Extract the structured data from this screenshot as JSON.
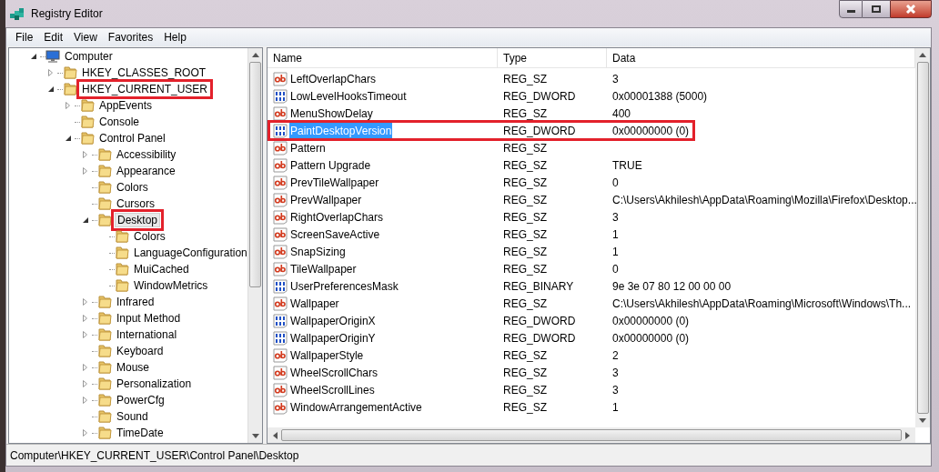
{
  "window": {
    "title": "Registry Editor"
  },
  "menu": [
    "File",
    "Edit",
    "View",
    "Favorites",
    "Help"
  ],
  "tree": [
    {
      "name": "Computer",
      "kind": "computer",
      "expanded": true,
      "children": [
        {
          "name": "HKEY_CLASSES_ROOT",
          "expanded": false
        },
        {
          "name": "HKEY_CURRENT_USER",
          "expanded": true,
          "highlighted": true,
          "children": [
            {
              "name": "AppEvents",
              "expanded": false
            },
            {
              "name": "Console"
            },
            {
              "name": "Control Panel",
              "expanded": true,
              "children": [
                {
                  "name": "Accessibility",
                  "expanded": false
                },
                {
                  "name": "Appearance",
                  "expanded": false
                },
                {
                  "name": "Colors"
                },
                {
                  "name": "Cursors"
                },
                {
                  "name": "Desktop",
                  "expanded": true,
                  "selected": true,
                  "highlighted": true,
                  "children": [
                    {
                      "name": "Colors"
                    },
                    {
                      "name": "LanguageConfiguration"
                    },
                    {
                      "name": "MuiCached"
                    },
                    {
                      "name": "WindowMetrics"
                    }
                  ]
                },
                {
                  "name": "Infrared",
                  "expanded": false
                },
                {
                  "name": "Input Method",
                  "expanded": false
                },
                {
                  "name": "International",
                  "expanded": false
                },
                {
                  "name": "Keyboard"
                },
                {
                  "name": "Mouse",
                  "expanded": false
                },
                {
                  "name": "Personalization",
                  "expanded": false
                },
                {
                  "name": "PowerCfg",
                  "expanded": false
                },
                {
                  "name": "Sound"
                },
                {
                  "name": "TimeDate",
                  "expanded": false
                }
              ]
            }
          ]
        }
      ]
    }
  ],
  "table": {
    "columns": [
      "Name",
      "Type",
      "Data"
    ],
    "rows": [
      {
        "kind": "sz",
        "name": "LeftOverlapChars",
        "type": "REG_SZ",
        "data": "3",
        "selected": false,
        "highlighted": false
      },
      {
        "kind": "bin",
        "name": "LowLevelHooksTimeout",
        "type": "REG_DWORD",
        "data": "0x00001388 (5000)",
        "selected": false,
        "highlighted": false
      },
      {
        "kind": "sz",
        "name": "MenuShowDelay",
        "type": "REG_SZ",
        "data": "400",
        "selected": false,
        "highlighted": false
      },
      {
        "kind": "bin",
        "name": "PaintDesktopVersion",
        "type": "REG_DWORD",
        "data": "0x00000000 (0)",
        "selected": true,
        "highlighted": true
      },
      {
        "kind": "sz",
        "name": "Pattern",
        "type": "REG_SZ",
        "selected": false,
        "highlighted": false
      },
      {
        "kind": "sz",
        "name": "Pattern Upgrade",
        "type": "REG_SZ",
        "data": "TRUE",
        "selected": false,
        "highlighted": false
      },
      {
        "kind": "sz",
        "name": "PrevTileWallpaper",
        "type": "REG_SZ",
        "data": "0",
        "selected": false,
        "highlighted": false
      },
      {
        "kind": "sz",
        "name": "PrevWallpaper",
        "type": "REG_SZ",
        "data": "C:\\Users\\Akhilesh\\AppData\\Roaming\\Mozilla\\Firefox\\Desktop...",
        "selected": false,
        "highlighted": false
      },
      {
        "kind": "sz",
        "name": "RightOverlapChars",
        "type": "REG_SZ",
        "data": "3",
        "selected": false,
        "highlighted": false
      },
      {
        "kind": "sz",
        "name": "ScreenSaveActive",
        "type": "REG_SZ",
        "data": "1",
        "selected": false,
        "highlighted": false
      },
      {
        "kind": "sz",
        "name": "SnapSizing",
        "type": "REG_SZ",
        "data": "1",
        "selected": false,
        "highlighted": false
      },
      {
        "kind": "sz",
        "name": "TileWallpaper",
        "type": "REG_SZ",
        "data": "0",
        "selected": false,
        "highlighted": false
      },
      {
        "kind": "bin",
        "name": "UserPreferencesMask",
        "type": "REG_BINARY",
        "data": "9e 3e 07 80 12 00 00 00",
        "selected": false,
        "highlighted": false
      },
      {
        "kind": "sz",
        "name": "Wallpaper",
        "type": "REG_SZ",
        "data": "C:\\Users\\Akhilesh\\AppData\\Roaming\\Microsoft\\Windows\\Th...",
        "selected": false,
        "highlighted": false
      },
      {
        "kind": "bin",
        "name": "WallpaperOriginX",
        "type": "REG_DWORD",
        "data": "0x00000000 (0)",
        "selected": false,
        "highlighted": false
      },
      {
        "kind": "bin",
        "name": "WallpaperOriginY",
        "type": "REG_DWORD",
        "data": "0x00000000 (0)",
        "selected": false,
        "highlighted": false
      },
      {
        "kind": "sz",
        "name": "WallpaperStyle",
        "type": "REG_SZ",
        "data": "2",
        "selected": false,
        "highlighted": false
      },
      {
        "kind": "sz",
        "name": "WheelScrollChars",
        "type": "REG_SZ",
        "data": "3",
        "selected": false,
        "highlighted": false
      },
      {
        "kind": "sz",
        "name": "WheelScrollLines",
        "type": "REG_SZ",
        "data": "3",
        "selected": false,
        "highlighted": false
      },
      {
        "kind": "sz",
        "name": "WindowArrangementActive",
        "type": "REG_SZ",
        "data": "1",
        "selected": false,
        "highlighted": false
      }
    ]
  },
  "status_bar": "Computer\\HKEY_CURRENT_USER\\Control Panel\\Desktop"
}
